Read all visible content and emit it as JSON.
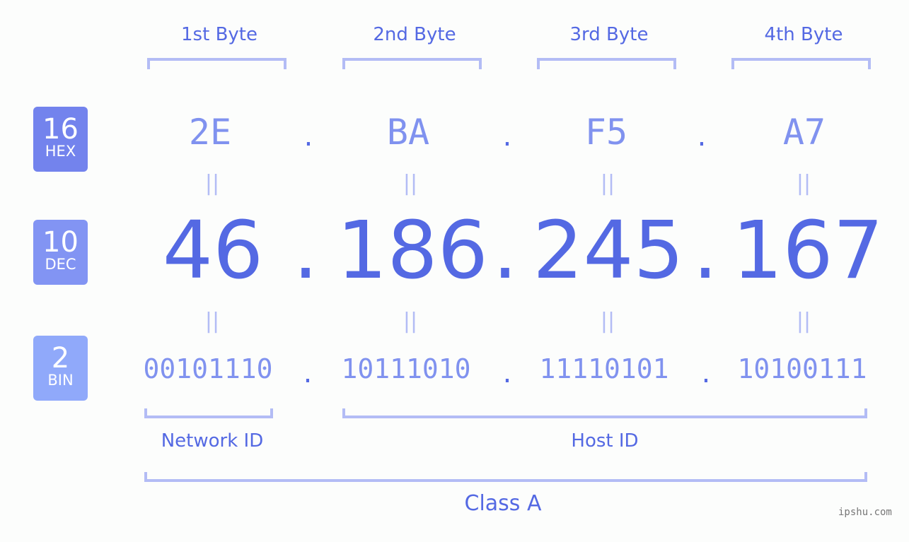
{
  "byte_labels": [
    "1st Byte",
    "2nd Byte",
    "3rd Byte",
    "4th Byte"
  ],
  "badges": {
    "hex": {
      "num": "16",
      "label": "HEX",
      "color": "#7383ed"
    },
    "dec": {
      "num": "10",
      "label": "DEC",
      "color": "#8294f3"
    },
    "bin": {
      "num": "2",
      "label": "BIN",
      "color": "#90a9fa"
    }
  },
  "hex": [
    "2E",
    "BA",
    "F5",
    "A7"
  ],
  "dec": [
    "46",
    "186",
    "245",
    "167"
  ],
  "bin": [
    "00101110",
    "10111010",
    "11110101",
    "10100111"
  ],
  "separator": ".",
  "equals": "||",
  "network_label": "Network ID",
  "host_label": "Host ID",
  "class_label": "Class A",
  "watermark": "ipshu.com"
}
